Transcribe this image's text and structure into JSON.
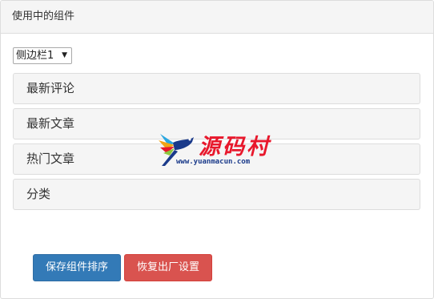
{
  "panel": {
    "title": "使用中的组件"
  },
  "sidebar_select": {
    "selected": "侧边栏1"
  },
  "widgets": [
    {
      "label": "最新评论"
    },
    {
      "label": "最新文章"
    },
    {
      "label": "热门文章"
    },
    {
      "label": "分类"
    }
  ],
  "buttons": {
    "save_label": "保存组件排序",
    "reset_label": "恢复出厂设置"
  },
  "watermark": {
    "title": "源码村",
    "url": "www.yuanmacun.com"
  },
  "colors": {
    "primary": "#337ab7",
    "danger": "#d9534f",
    "watermark_red": "#e8182c",
    "watermark_blue": "#1a3a8a"
  }
}
